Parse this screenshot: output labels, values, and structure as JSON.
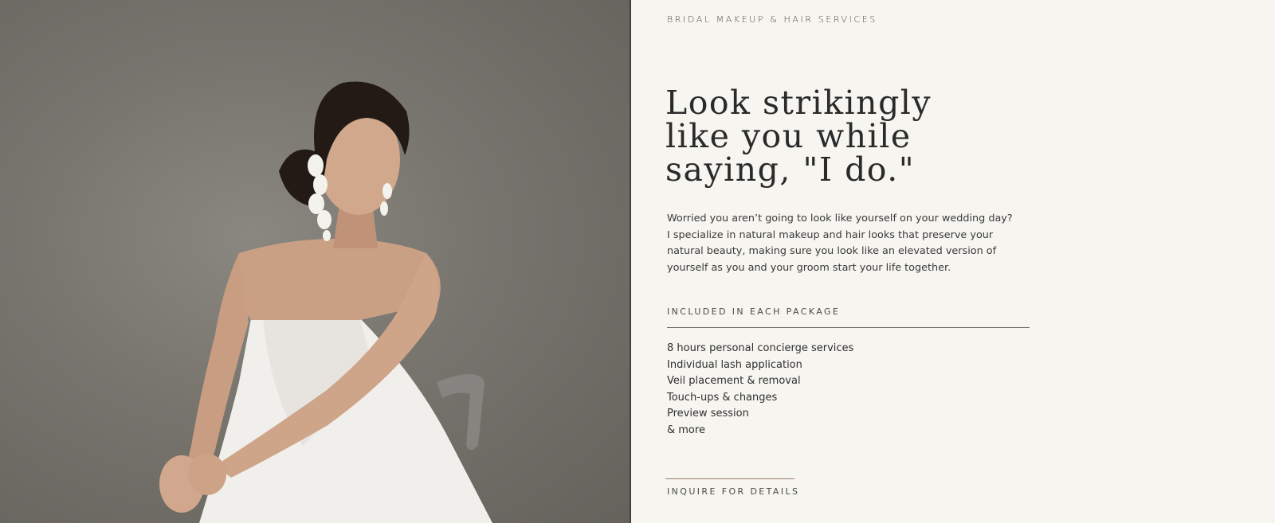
{
  "hero": {
    "image_alt": "Bride in white strapless gown with floral earrings seated on a clear chair"
  },
  "content": {
    "eyebrow": "BRIDAL MAKEUP & HAIR SERVICES",
    "headline_lines": [
      "Look strikingly",
      "like you while",
      "saying, \"I do.\""
    ],
    "intro": "Worried you aren’t going to look like yourself on your wedding day? I specialize in natural makeup and hair looks that preserve your natural beauty, making sure you look like an elevated version of yourself as you and your groom start your life together.",
    "package": {
      "label": "INCLUDED IN EACH PACKAGE",
      "items": [
        "8 hours personal concierge services",
        "Individual lash application",
        "Veil placement & removal",
        "Touch-ups & changes",
        "Preview session",
        "& more"
      ]
    },
    "cta_label": "INQUIRE FOR DETAILS"
  },
  "colors": {
    "background": "#f6f5f0",
    "photo_backdrop": "#77746e",
    "divider": "#4a3f37",
    "accent_rule": "#9c7b6e"
  }
}
